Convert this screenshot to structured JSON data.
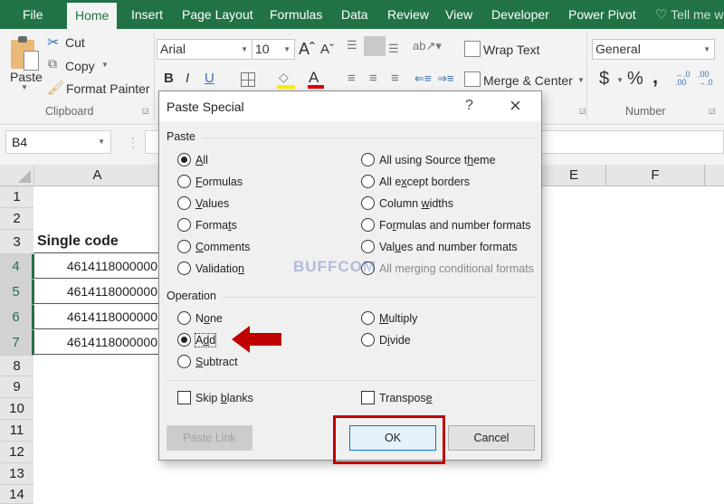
{
  "ribbon_tabs": [
    "File",
    "Home",
    "Insert",
    "Page Layout",
    "Formulas",
    "Data",
    "Review",
    "View",
    "Developer",
    "Power Pivot"
  ],
  "tell_me": "Tell me w",
  "clipboard": {
    "paste": "Paste",
    "cut": "Cut",
    "copy": "Copy",
    "format_painter": "Format Painter",
    "group": "Clipboard"
  },
  "font": {
    "name": "Arial",
    "size": "10",
    "bold": "B",
    "italic": "I",
    "underline": "U",
    "font_color": "A"
  },
  "alignment": {
    "wrap_text": "Wrap Text",
    "merge_center": "Merge & Center"
  },
  "number": {
    "format": "General",
    "currency": "$",
    "percent": "%",
    "comma": ",",
    "group": "Number",
    "inc_decimal": "←.0 .00",
    "dec_decimal": ".00 →.0"
  },
  "name_box": "B4",
  "columns": [
    "A",
    "E",
    "F"
  ],
  "rows": [
    "1",
    "2",
    "3",
    "4",
    "5",
    "6",
    "7",
    "8",
    "9",
    "10",
    "11",
    "12",
    "13",
    "14"
  ],
  "cells": {
    "A3": "Single code",
    "A4": "4614118000000",
    "A5": "4614118000000",
    "A6": "4614118000000",
    "A7": "4614118000000"
  },
  "dialog": {
    "title": "Paste Special",
    "help": "?",
    "close": "×",
    "paste_label": "Paste",
    "paste_left": [
      {
        "pre": "",
        "u": "A",
        "post": "ll",
        "checked": true
      },
      {
        "pre": "",
        "u": "F",
        "post": "ormulas",
        "checked": false
      },
      {
        "pre": "",
        "u": "V",
        "post": "alues",
        "checked": false
      },
      {
        "pre": "Forma",
        "u": "t",
        "post": "s",
        "checked": false
      },
      {
        "pre": "",
        "u": "C",
        "post": "omments",
        "checked": false
      },
      {
        "pre": "Validatio",
        "u": "n",
        "post": "",
        "checked": false
      }
    ],
    "paste_right": [
      {
        "pre": "All using Source t",
        "u": "h",
        "post": "eme",
        "checked": false
      },
      {
        "pre": "All e",
        "u": "x",
        "post": "cept borders",
        "checked": false
      },
      {
        "pre": "Column ",
        "u": "w",
        "post": "idths",
        "checked": false
      },
      {
        "pre": "Fo",
        "u": "r",
        "post": "mulas and number formats",
        "checked": false
      },
      {
        "pre": "Val",
        "u": "u",
        "post": "es and number formats",
        "checked": false
      },
      {
        "pre": "All merging conditional formats",
        "u": "",
        "post": "",
        "checked": false
      }
    ],
    "operation_label": "Operation",
    "op_left": [
      {
        "pre": "N",
        "u": "o",
        "post": "ne",
        "checked": false
      },
      {
        "pre": "A",
        "u": "d",
        "post": "d",
        "checked": true
      },
      {
        "pre": "",
        "u": "S",
        "post": "ubtract",
        "checked": false
      }
    ],
    "op_right": [
      {
        "pre": "",
        "u": "M",
        "post": "ultiply",
        "checked": false
      },
      {
        "pre": "D",
        "u": "i",
        "post": "vide",
        "checked": false
      }
    ],
    "skip_blanks": {
      "pre": "Skip ",
      "u": "b",
      "post": "lanks",
      "checked": false
    },
    "transpose": {
      "pre": "Transpos",
      "u": "e",
      "post": "",
      "checked": false
    },
    "paste_link": "Paste Link",
    "ok": "OK",
    "cancel": "Cancel"
  },
  "watermark": "BUFFCOM",
  "annotation_color": "#c00000"
}
